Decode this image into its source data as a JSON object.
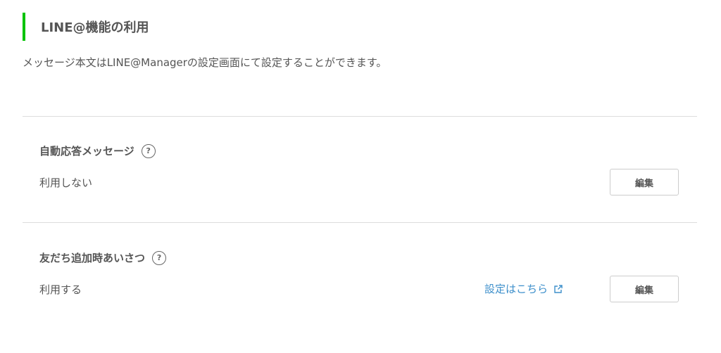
{
  "section": {
    "title": "LINE@機能の利用",
    "accent_color": "#00c300",
    "description": "メッセージ本文はLINE@Managerの設定画面にて設定することができます。"
  },
  "items": [
    {
      "title": "自動応答メッセージ",
      "help_icon": "?",
      "value": "利用しない",
      "edit_label": "編集"
    },
    {
      "title": "友だち追加時あいさつ",
      "help_icon": "?",
      "value": "利用する",
      "link_label": "設定はこちら",
      "link_icon": "external-link-icon",
      "edit_label": "編集"
    }
  ],
  "colors": {
    "link": "#3d8fcb",
    "divider": "#dddddd"
  }
}
